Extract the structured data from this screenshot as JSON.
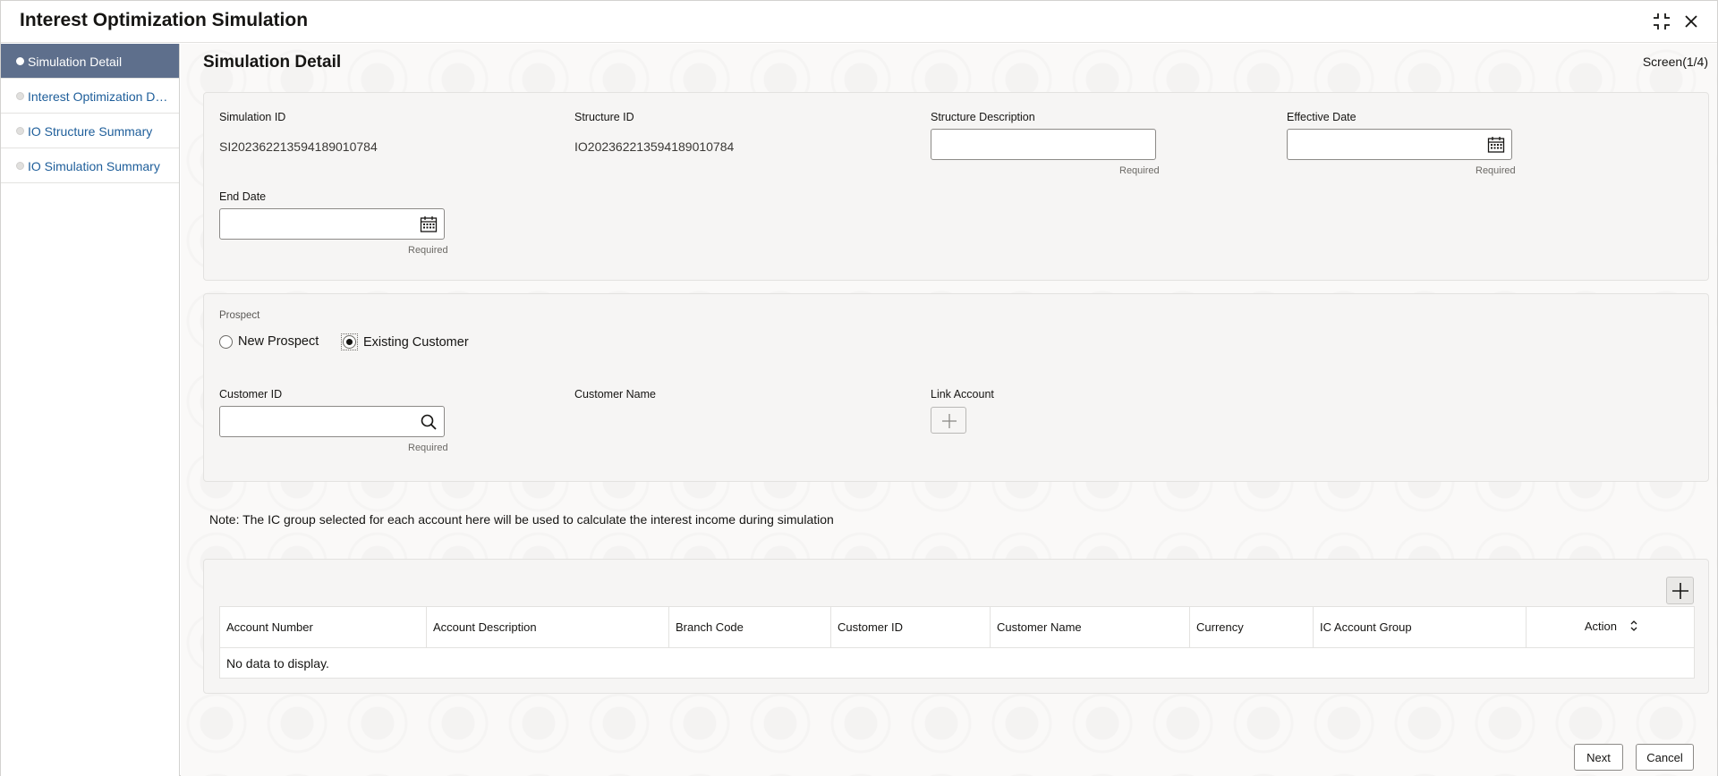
{
  "header": {
    "title": "Interest Optimization Simulation"
  },
  "nav": {
    "items": [
      {
        "label": "Simulation Detail",
        "active": true
      },
      {
        "label": "Interest Optimization D…",
        "active": false
      },
      {
        "label": "IO Structure Summary",
        "active": false
      },
      {
        "label": "IO Simulation Summary",
        "active": false
      }
    ]
  },
  "main": {
    "title": "Simulation Detail",
    "screen_indicator": "Screen(1/4)"
  },
  "details": {
    "simulation_id_label": "Simulation ID",
    "simulation_id_value": "SI20236221359418901078​4",
    "structure_id_label": "Structure ID",
    "structure_id_value": "IO202362213594189010784",
    "structure_description_label": "Structure Description",
    "structure_description_value": "",
    "effective_date_label": "Effective Date",
    "effective_date_value": "",
    "end_date_label": "End Date",
    "end_date_value": "",
    "required_text": "Required"
  },
  "prospect": {
    "label": "Prospect",
    "options": [
      {
        "label": "New Prospect",
        "selected": false
      },
      {
        "label": "Existing Customer",
        "selected": true
      }
    ],
    "customer_id_label": "Customer ID",
    "customer_id_value": "",
    "customer_name_label": "Customer Name",
    "link_account_label": "Link Account"
  },
  "note": "Note: The IC group selected for each account here will be used to calculate the interest income during simulation",
  "grid": {
    "columns": [
      "Account Number",
      "Account Description",
      "Branch Code",
      "Customer ID",
      "Customer Name",
      "Currency",
      "IC Account Group",
      "Action"
    ],
    "empty_text": "No data to display."
  },
  "footer": {
    "next_label": "Next",
    "cancel_label": "Cancel"
  },
  "colors": {
    "nav_active_bg": "#5e6f8c",
    "link_text": "#1e5e9a"
  }
}
